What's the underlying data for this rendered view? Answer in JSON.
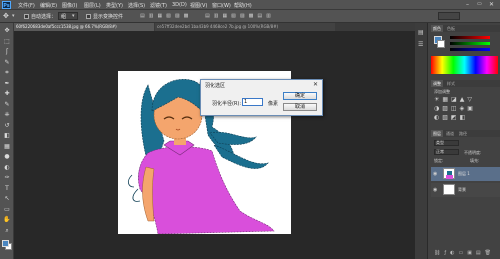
{
  "app": {
    "logo": "Ps"
  },
  "menu": [
    "文件(F)",
    "编辑(E)",
    "图像(I)",
    "图层(L)",
    "类型(Y)",
    "选择(S)",
    "滤镜(T)",
    "3D(D)",
    "视图(V)",
    "窗口(W)",
    "帮助(H)"
  ],
  "options": {
    "auto_select_label": "自动选择：",
    "auto_select_value": "组",
    "show_transform_label": "显示变换控件"
  },
  "tabs": [
    {
      "label": "60f6220683de0af5ccc1538.jpg @ 66.7%(RGB/8#)",
      "active": true
    },
    {
      "label": "ce57ff32dee2bd 1ba43b9 4468ce2 7b.jpg @ 100%(RGB/8#)",
      "active": false
    }
  ],
  "tools": [
    "move-icon",
    "marquee-icon",
    "lasso-icon",
    "quick-select-icon",
    "crop-icon",
    "eyedropper-icon",
    "healing-icon",
    "brush-icon",
    "stamp-icon",
    "history-brush-icon",
    "eraser-icon",
    "gradient-icon",
    "blur-icon",
    "dodge-icon",
    "pen-icon",
    "type-icon",
    "path-select-icon",
    "shape-icon",
    "hand-icon",
    "zoom-icon"
  ],
  "tool_glyphs": [
    "✥",
    "⬚",
    "ʃ",
    "✎",
    "⌗",
    "✒",
    "✚",
    "✎",
    "⎈",
    "↺",
    "◧",
    "▦",
    "●",
    "◐",
    "✑",
    "T",
    "↖",
    "▭",
    "✋",
    "⌕"
  ],
  "dialog": {
    "title": "羽化选区",
    "close": "✕",
    "radius_label": "羽化半径(R):",
    "radius_value": "1",
    "unit": "像素",
    "ok": "确定",
    "cancel": "取消"
  },
  "panels": {
    "color_tabs": [
      "颜色",
      "色板"
    ],
    "adjust_tabs": [
      "调整",
      "样式"
    ],
    "adjust_title": "添加调整",
    "layer_tabs": [
      "图层",
      "通道",
      "路径"
    ],
    "layer_filter": "类型",
    "blend_mode": "正常",
    "opacity_label": "不透明度:",
    "lock_label": "锁定:",
    "fill_label": "填充:",
    "layers": [
      {
        "name": "图层 1",
        "selected": true
      },
      {
        "name": "背景",
        "selected": false
      }
    ]
  },
  "colors": {
    "fg": "#4a86c0",
    "bg": "#ffffff",
    "hair": "#1b6f8f",
    "dress": "#d94fdb",
    "skin": "#f4a56d"
  }
}
